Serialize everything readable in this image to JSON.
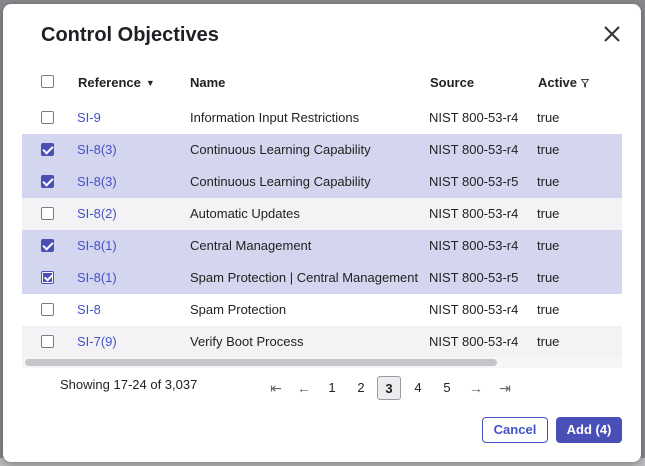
{
  "dialog": {
    "title": "Control Objectives",
    "close_label": "×"
  },
  "table": {
    "columns": {
      "reference": "Reference",
      "name": "Name",
      "source": "Source",
      "active": "Active"
    },
    "rows": [
      {
        "ref": "SI-9",
        "name": "Information Input Restrictions",
        "source": "NIST 800-53-r4",
        "active": "true",
        "checked": false
      },
      {
        "ref": "SI-8(3)",
        "name": "Continuous Learning Capability",
        "source": "NIST 800-53-r4",
        "active": "true",
        "checked": true
      },
      {
        "ref": "SI-8(3)",
        "name": "Continuous Learning Capability",
        "source": "NIST 800-53-r5",
        "active": "true",
        "checked": true
      },
      {
        "ref": "SI-8(2)",
        "name": "Automatic Updates",
        "source": "NIST 800-53-r4",
        "active": "true",
        "checked": false
      },
      {
        "ref": "SI-8(1)",
        "name": "Central Management",
        "source": "NIST 800-53-r4",
        "active": "true",
        "checked": true
      },
      {
        "ref": "SI-8(1)",
        "name": "Spam Protection | Central Management",
        "source": "NIST 800-53-r5",
        "active": "true",
        "checked": true
      },
      {
        "ref": "SI-8",
        "name": "Spam Protection",
        "source": "NIST 800-53-r4",
        "active": "true",
        "checked": false
      },
      {
        "ref": "SI-7(9)",
        "name": "Verify Boot Process",
        "source": "NIST 800-53-r4",
        "active": "true",
        "checked": false
      }
    ]
  },
  "pagination": {
    "summary": "Showing 17-24 of 3,037",
    "pages": [
      "1",
      "2",
      "3",
      "4",
      "5"
    ],
    "current": "3",
    "first_icon": "first-page-icon",
    "prev_icon": "prev-page-icon",
    "next_icon": "next-page-icon",
    "last_icon": "last-page-icon"
  },
  "footer": {
    "cancel_label": "Cancel",
    "add_label": "Add (4)"
  },
  "colors": {
    "accent": "#4a4fb8",
    "link": "#4353c4",
    "selected_row": "#d4d5ee"
  }
}
